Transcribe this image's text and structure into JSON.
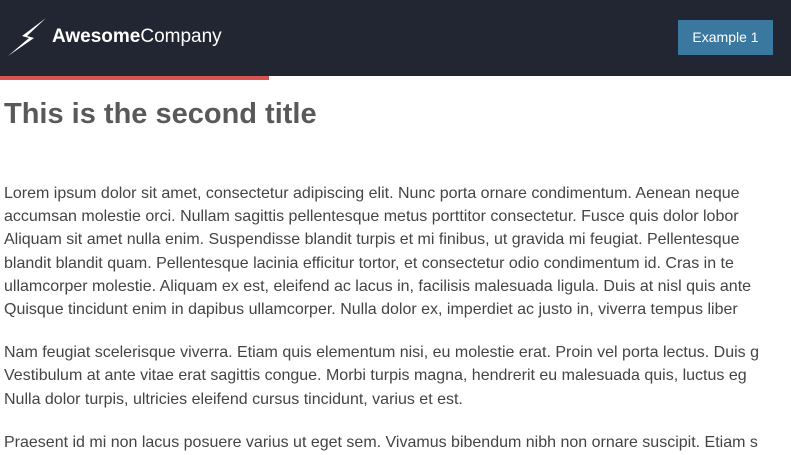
{
  "header": {
    "brand_bold": "Awesome",
    "brand_light": "Company",
    "button_label": "Example 1",
    "colors": {
      "background": "#222632",
      "button": "#3a78a0",
      "progress": "#d9534f"
    },
    "logo_icon": "lightning-bolt-icon"
  },
  "progress": {
    "value_percent": 34
  },
  "main": {
    "title": "This is the second title",
    "paragraphs": [
      {
        "lines": [
          "Lorem ipsum dolor sit amet, consectetur adipiscing elit. Nunc porta ornare condimentum. Aenean neque",
          "accumsan molestie orci. Nullam sagittis pellentesque metus porttitor consectetur. Fusce quis dolor lobor",
          "Aliquam sit amet nulla enim. Suspendisse blandit turpis et mi finibus, ut gravida mi feugiat. Pellentesque",
          "blandit blandit quam. Pellentesque lacinia efficitur tortor, et consectetur odio condimentum id. Cras in te",
          "ullamcorper molestie. Aliquam ex est, eleifend ac lacus in, facilisis malesuada ligula. Duis at nisl quis ante",
          "Quisque tincidunt enim in dapibus ullamcorper. Nulla dolor ex, imperdiet ac justo in, viverra tempus liber"
        ]
      },
      {
        "lines": [
          "Nam feugiat scelerisque viverra. Etiam quis elementum nisi, eu molestie erat. Proin vel porta lectus. Duis g",
          "Vestibulum at ante vitae erat sagittis congue. Morbi turpis magna, hendrerit eu malesuada quis, luctus eg",
          "Nulla dolor turpis, ultricies eleifend cursus tincidunt, varius et est."
        ]
      },
      {
        "lines": [
          "Praesent id mi non lacus posuere varius ut eget sem. Vivamus bibendum nibh non ornare suscipit. Etiam s"
        ]
      }
    ]
  }
}
